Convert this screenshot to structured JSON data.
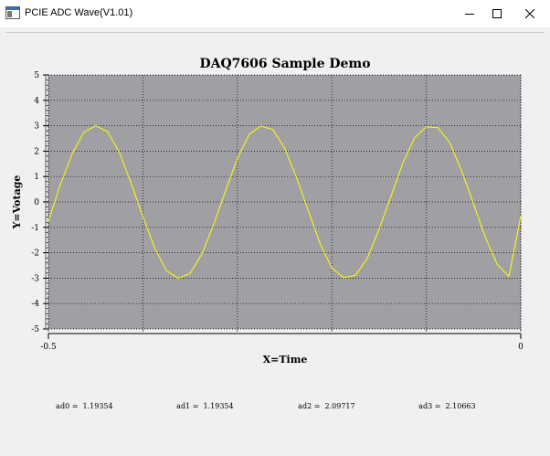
{
  "window": {
    "title": "PCIE ADC Wave(V1.01)"
  },
  "readouts": [
    {
      "label": "ad0 =",
      "value": "1.19354"
    },
    {
      "label": "ad1 =",
      "value": "1.19354"
    },
    {
      "label": "ad2 =",
      "value": "2.09717"
    },
    {
      "label": "ad3 =",
      "value": "2.10663"
    }
  ],
  "colors": {
    "plot_background": "#a0a0a4",
    "trace": "#ffff00",
    "window_background": "#f0f0f0"
  },
  "chart_data": {
    "type": "line",
    "title": "DAQ7606 Sample Demo",
    "xlabel": "X=Time",
    "ylabel": "Y=Votage",
    "xlim": [
      -0.5,
      0
    ],
    "ylim": [
      -5,
      5
    ],
    "x_ticks": [
      -0.5,
      0
    ],
    "x_tick_labels": [
      "-0.5",
      "0"
    ],
    "y_ticks": [
      -5,
      -4,
      -3,
      -2,
      -1,
      0,
      1,
      2,
      3,
      4,
      5
    ],
    "grid": true,
    "series": [
      {
        "x": [
          -0.5,
          -0.4875,
          -0.475,
          -0.4625,
          -0.45,
          -0.4375,
          -0.425,
          -0.4125,
          -0.4,
          -0.3875,
          -0.375,
          -0.3625,
          -0.35,
          -0.3375,
          -0.325,
          -0.3125,
          -0.3,
          -0.2875,
          -0.275,
          -0.2625,
          -0.25,
          -0.2375,
          -0.225,
          -0.2125,
          -0.2,
          -0.1875,
          -0.175,
          -0.1625,
          -0.15,
          -0.1375,
          -0.125,
          -0.1125,
          -0.1,
          -0.0875,
          -0.075,
          -0.0625,
          -0.05,
          -0.0375,
          -0.025,
          -0.0125,
          0
        ],
        "y": [
          -0.77,
          0.67,
          1.89,
          2.74,
          3.0,
          2.77,
          1.96,
          0.74,
          -0.58,
          -1.81,
          -2.71,
          -3.0,
          -2.81,
          -2.05,
          -0.88,
          0.44,
          1.71,
          2.65,
          2.99,
          2.85,
          2.13,
          0.97,
          -0.34,
          -1.63,
          -2.6,
          -2.98,
          -2.89,
          -2.22,
          -1.08,
          0.21,
          1.52,
          2.52,
          2.96,
          2.92,
          2.32,
          1.21,
          -0.07,
          -1.39,
          -2.45,
          -2.93,
          -0.55
        ]
      }
    ]
  }
}
